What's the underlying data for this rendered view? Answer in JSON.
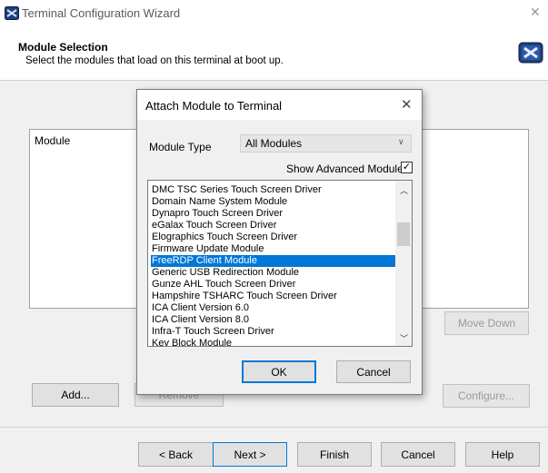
{
  "window": {
    "title": "Terminal Configuration Wizard"
  },
  "header": {
    "title": "Module Selection",
    "subtitle": "Select the modules that load on this terminal at boot up."
  },
  "module_list": {
    "column_header": "Module"
  },
  "side_buttons": {
    "move_down": "Move Down",
    "configure": "Configure..."
  },
  "bottom_buttons": {
    "add": "Add...",
    "remove": "Remove"
  },
  "footer": {
    "back": "< Back",
    "next": "Next >",
    "finish": "Finish",
    "cancel": "Cancel",
    "help": "Help"
  },
  "dialog": {
    "title": "Attach Module to Terminal",
    "module_type_label": "Module Type",
    "module_type_value": "All Modules",
    "show_advanced_label": "Show Advanced Modules",
    "show_advanced_checked": true,
    "check_glyph": "✓",
    "selected_index": 6,
    "items": [
      "DMC TSC Series Touch Screen Driver",
      "Domain Name System Module",
      "Dynapro Touch Screen Driver",
      "eGalax Touch Screen Driver",
      "Elographics Touch Screen Driver",
      "Firmware Update Module",
      "FreeRDP Client Module",
      "Generic USB Redirection Module",
      "Gunze AHL Touch Screen Driver",
      "Hampshire TSHARC Touch Screen Driver",
      "ICA Client Version 6.0",
      "ICA Client Version 8.0",
      "Infra-T Touch Screen Driver",
      "Key Block Module"
    ],
    "ok": "OK",
    "cancel": "Cancel"
  },
  "colors": {
    "selection": "#0078d7",
    "window_bg": "#f0f0f0"
  },
  "icons": {
    "app": "terminal-wizard-icon",
    "header": "terminal-wizard-icon"
  }
}
